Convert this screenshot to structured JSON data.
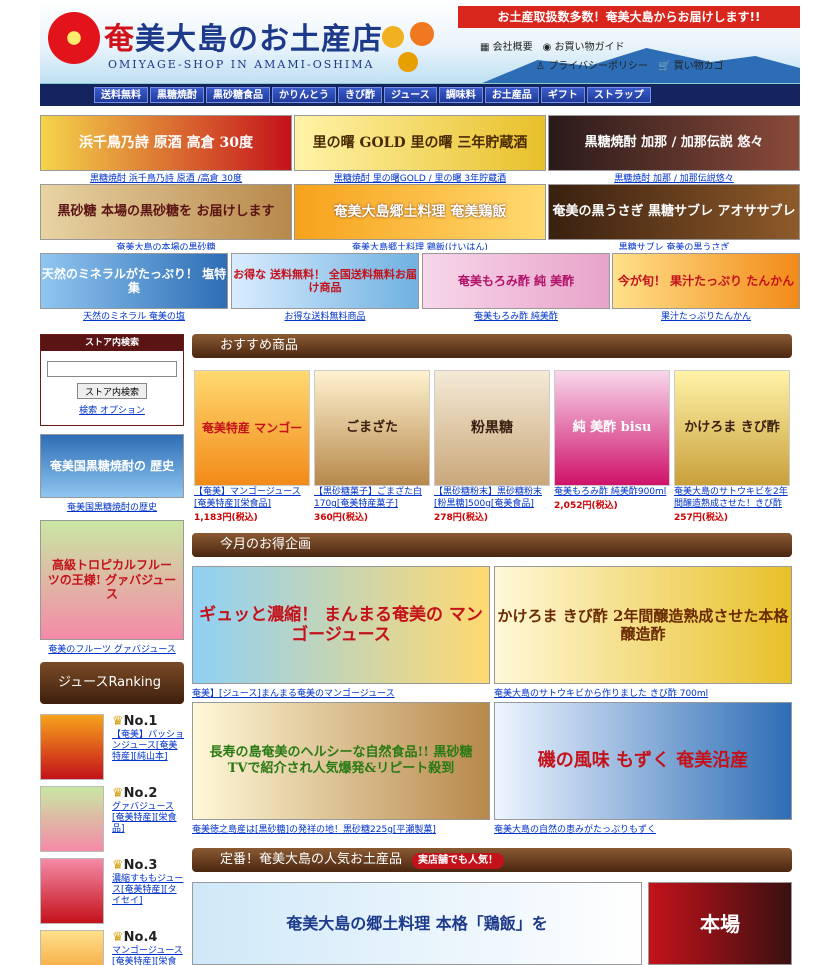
{
  "header": {
    "title_red": "奄",
    "title_rest": "美大島のお土産店",
    "subtitle": "OMIYAGE-SHOP IN AMAMI-OSHIMA",
    "banner": "お土産取扱数多数！奄美大島からお届けします!!",
    "links": [
      "会社概要",
      "お買い物ガイド",
      "プライバシーポリシー",
      "買い物カゴ"
    ]
  },
  "nav": [
    "送料無料",
    "黒糖焼酎",
    "黒砂糖食品",
    "かりんとう",
    "きび酢",
    "ジュース",
    "調味料",
    "お土産品",
    "ギフト",
    "ストラップ"
  ],
  "banners_row1": [
    {
      "img": "浜千鳥乃詩 原酒 高倉 30度",
      "caption": "黒糖焼酎 浜千鳥乃詩 原酒 /高倉 30度"
    },
    {
      "img": "里の曙 GOLD 里の曙 三年貯蔵酒",
      "caption": "黒糖焼酎 里の曙GOLD / 里の曙 3年貯蔵酒"
    },
    {
      "img": "黒糖焼酎 加那 / 加那伝説 悠々",
      "caption": "黒糖焼酎 加那 / 加那伝説悠々"
    }
  ],
  "banners_row2": [
    {
      "img": "黒砂糖 本場の黒砂糖を お届けします",
      "caption": "奄美大島の本場の黒砂糖"
    },
    {
      "img": "奄美大島郷土料理 奄美鶏飯",
      "caption": "奄美大島郷土料理 鶏飯(けいはん)"
    },
    {
      "img": "奄美の黒うさぎ 黒糖サブレ アオササブレ",
      "caption": "黒糖サブレ 奄美の黒うさぎ"
    }
  ],
  "banners_row3": [
    {
      "img": "天然のミネラルがたっぷり！ 塩特集",
      "caption": "天然のミネラル 奄美の塩"
    },
    {
      "img": "お得な 送料無料！ 全国送料無料お届け商品",
      "caption": "お得な送料無料商品"
    },
    {
      "img": "奄美もろみ酢 純 美酢",
      "caption": "奄美もろみ酢 純美酢"
    },
    {
      "img": "今が旬！ 果汁たっぷり たんかん",
      "caption": "果汁たっぷりたんかん"
    }
  ],
  "sidebar": {
    "search_title": "ストア内検索",
    "search_button": "ストア内検索",
    "search_option": "検索 オプション",
    "history_banner": "奄美国黒糖焼酎の 歴史",
    "history_caption": "奄美国黒糖焼酎の歴史",
    "guava_banner": "高級トロピカルフルーツの王様! グァバジュース",
    "guava_caption": "奄美のフルーツ グァバジュース",
    "ranking_title": "ジュースRanking",
    "ranking": [
      {
        "no": "No.1",
        "name": "【奄美】パッションジュース[奄美特産][純山本]"
      },
      {
        "no": "No.2",
        "name": "グァバジュース[奄美特産][栄食品]"
      },
      {
        "no": "No.3",
        "name": "濃縮すももジュース[奄美特産][タイセイ]"
      },
      {
        "no": "No.4",
        "name": "マンゴージュース[奄美特産][栄食品]"
      }
    ]
  },
  "main": {
    "section1": "おすすめ商品",
    "products": [
      {
        "img": "奄美特産 マンゴー",
        "name": "【奄美】マンゴージュース[奄美特産][栄食品]",
        "price": "1,183円(税込)"
      },
      {
        "img": "ごまざた",
        "name": "【黒砂糖菓子】ごまざた白170g[奄美特産菓子]",
        "price": "360円(税込)"
      },
      {
        "img": "粉黒糖",
        "name": "【黒砂糖粉末】黒砂糖粉末[粉黒糖]500g[奄美食品]",
        "price": "278円(税込)"
      },
      {
        "img": "純 美酢 bisu",
        "name": "奄美もろみ酢 純美酢900ml",
        "price": "2,052円(税込)"
      },
      {
        "img": "かけろま きび酢",
        "name": "奄美大島のサトウキビを2年間醸造熟成させた！きび酢",
        "price": "257円(税込)"
      }
    ],
    "section2": "今月のお得企画",
    "promos": [
      {
        "img": "ギュッと濃縮！ まんまる奄美の マンゴージュース",
        "caption": "奄美】[ジュース]まんまる奄美のマンゴージュース"
      },
      {
        "img": "かけろま きび酢 2年間醸造熟成させた本格醸造酢",
        "caption": "奄美大島のサトウキビから作りました きび酢 700ml"
      },
      {
        "img": "長寿の島奄美のヘルシーな自然食品!! 黒砂糖 TVで紹介され人気爆発&リピート殺到",
        "caption": "奄美徳之島産は[黒砂糖]の発祥の地！黒砂糖225g[平瀬製菓]"
      },
      {
        "img": "磯の風味 もずく 奄美沿産",
        "caption": "奄美大島の自然の恵みがたっぷりもずく"
      }
    ],
    "section3": "定番！奄美大島の人気お土産品",
    "section3_badge": "実店舗でも人気！",
    "bottom_banner": "奄美大島の郷土料理 本格「鶏飯」を",
    "bottom_banner2": "本場"
  },
  "colors": {
    "nav_bg": "#13245f",
    "banner_red": "#d9261c",
    "section_brown": "#6a3d1e",
    "link": "#0033cc",
    "price": "#cc0000"
  }
}
